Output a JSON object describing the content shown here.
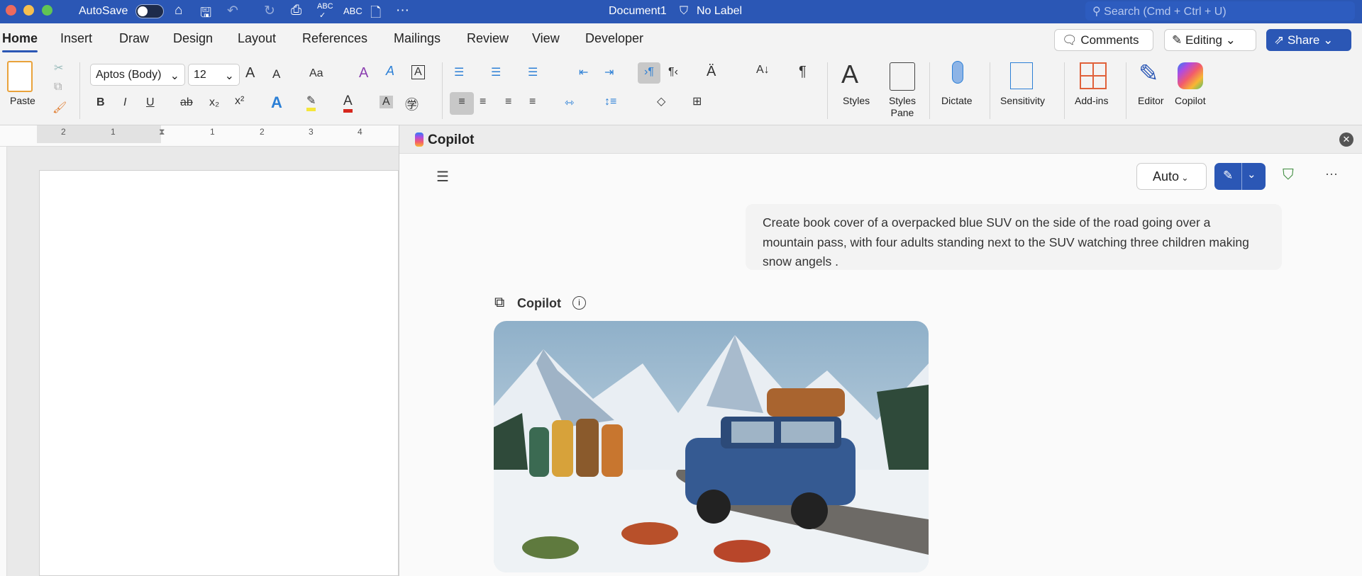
{
  "titlebar": {
    "autosave": "AutoSave",
    "document": "Document1",
    "label": "No Label",
    "search_placeholder": "Search (Cmd + Ctrl + U)"
  },
  "tabs": [
    "Home",
    "Insert",
    "Draw",
    "Design",
    "Layout",
    "References",
    "Mailings",
    "Review",
    "View",
    "Developer"
  ],
  "actions": {
    "comments": "Comments",
    "editing": "Editing",
    "share": "Share"
  },
  "ribbon": {
    "paste": "Paste",
    "font": "Aptos (Body)",
    "size": "12",
    "styles": "Styles",
    "styles_pane": "Styles Pane",
    "dictate": "Dictate",
    "sensitivity": "Sensitivity",
    "addins": "Add-ins",
    "editor": "Editor",
    "copilot": "Copilot",
    "format": {
      "bold": "B",
      "italic": "I",
      "underline": "U",
      "strike": "ab",
      "sub": "x₂",
      "sup": "x²",
      "case": "Aa",
      "grow": "A",
      "shrink": "A",
      "pilcrow": "¶"
    }
  },
  "ruler": [
    "2",
    "1",
    "1",
    "2",
    "3",
    "4"
  ],
  "copilot": {
    "title": "Copilot",
    "mode": "Auto",
    "user_message": "Create book cover of a overpacked blue SUV on the side of the road going over a mountain pass, with four adults standing next to the SUV watching three children making snow angels .",
    "response_label": "Copilot"
  },
  "colors": {
    "brand": "#2b57b5",
    "highlight": "#f5e63a",
    "font_color": "#d6271d"
  }
}
